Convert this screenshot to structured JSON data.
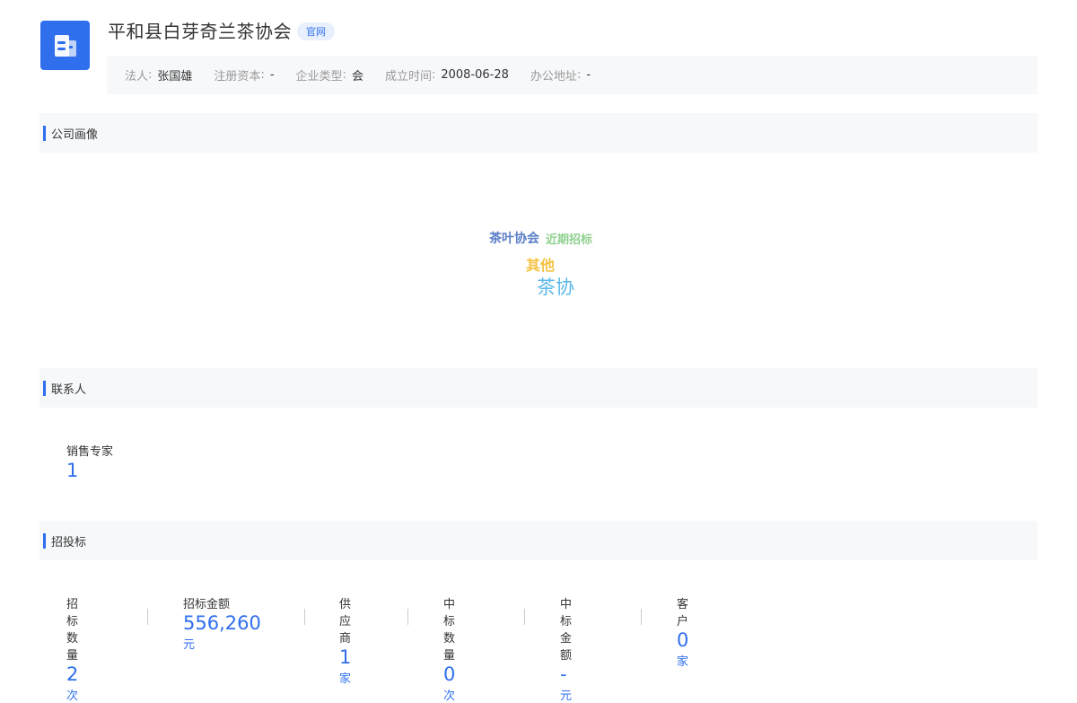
{
  "company": {
    "name": "平和县白芽奇兰茶协会",
    "badge": "官网"
  },
  "info": [
    {
      "label": "法人",
      "value": "张国雄"
    },
    {
      "label": "注册资本",
      "value": "-"
    },
    {
      "label": "企业类型",
      "value": "会"
    },
    {
      "label": "成立时间",
      "value": "2008-06-28"
    },
    {
      "label": "办公地址",
      "value": "-"
    }
  ],
  "info_colon": ":",
  "sections": {
    "portrait": "公司画像",
    "contacts": "联系人",
    "bidding": "招投标"
  },
  "word_cloud": [
    {
      "text": "茶叶协会",
      "color": "#5b7fc7"
    },
    {
      "text": "近期招标",
      "color": "#8fd18f"
    },
    {
      "text": "其他",
      "color": "#f5c342"
    },
    {
      "text": "茶协",
      "color": "#5ab7ea"
    }
  ],
  "contacts": {
    "label": "销售专家",
    "value": "1"
  },
  "bidding_stats": [
    {
      "label": "招标数量",
      "value": "2",
      "unit": "次"
    },
    {
      "label": "招标金额",
      "value": "556,260",
      "unit": "元"
    },
    {
      "label": "供应商",
      "value": "1",
      "unit": "家"
    },
    {
      "label": "中标数量",
      "value": "0",
      "unit": "次"
    },
    {
      "label": "中标金额",
      "value": "-",
      "unit": "元"
    },
    {
      "label": "客户",
      "value": "0",
      "unit": "家"
    }
  ],
  "colors": {
    "accent": "#2f6fed",
    "section_bg": "#f7f8fa"
  },
  "icons": {
    "logo": "building-icon"
  }
}
